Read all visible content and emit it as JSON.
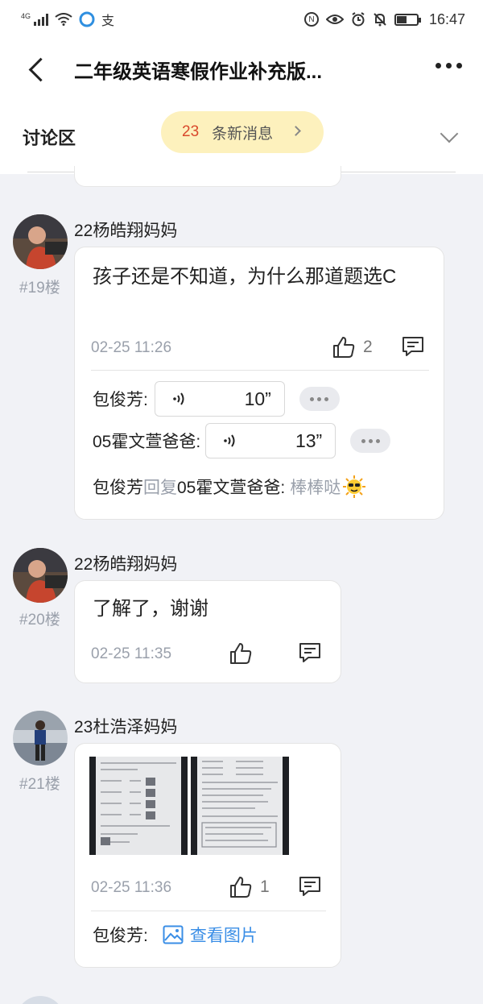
{
  "status_bar": {
    "network": "4G",
    "app_glyph": "支",
    "nfc": "N",
    "time": "16:47"
  },
  "header": {
    "title": "二年级英语寒假作业补充版..."
  },
  "discussion": {
    "label": "讨论区",
    "new_count": "23",
    "new_text": "条新消息"
  },
  "posts": [
    {
      "author": "22杨皓翔妈妈",
      "floor": "#19楼",
      "message": "孩子还是不知道，为什么那道题选C",
      "time": "02-25 11:26",
      "likes": "2",
      "replies": [
        {
          "name": "包俊芳:",
          "duration": "10”"
        },
        {
          "name": "05霍文萱爸爸:",
          "duration": "13”"
        }
      ],
      "text_reply": {
        "from": "包俊芳",
        "verb": "回复",
        "to": "05霍文萱爸爸:",
        "content": "棒棒哒"
      }
    },
    {
      "author": "22杨皓翔妈妈",
      "floor": "#20楼",
      "message": "了解了，谢谢",
      "time": "02-25 11:35",
      "likes": ""
    },
    {
      "author": "23杜浩泽妈妈",
      "floor": "#21楼",
      "time": "02-25 11:36",
      "likes": "1",
      "reply_name": "包俊芳:",
      "reply_link": "查看图片"
    }
  ],
  "colors": {
    "accent_red": "#d9492c",
    "link_blue": "#3a8ee6",
    "pill_bg": "#fdf1bd"
  }
}
